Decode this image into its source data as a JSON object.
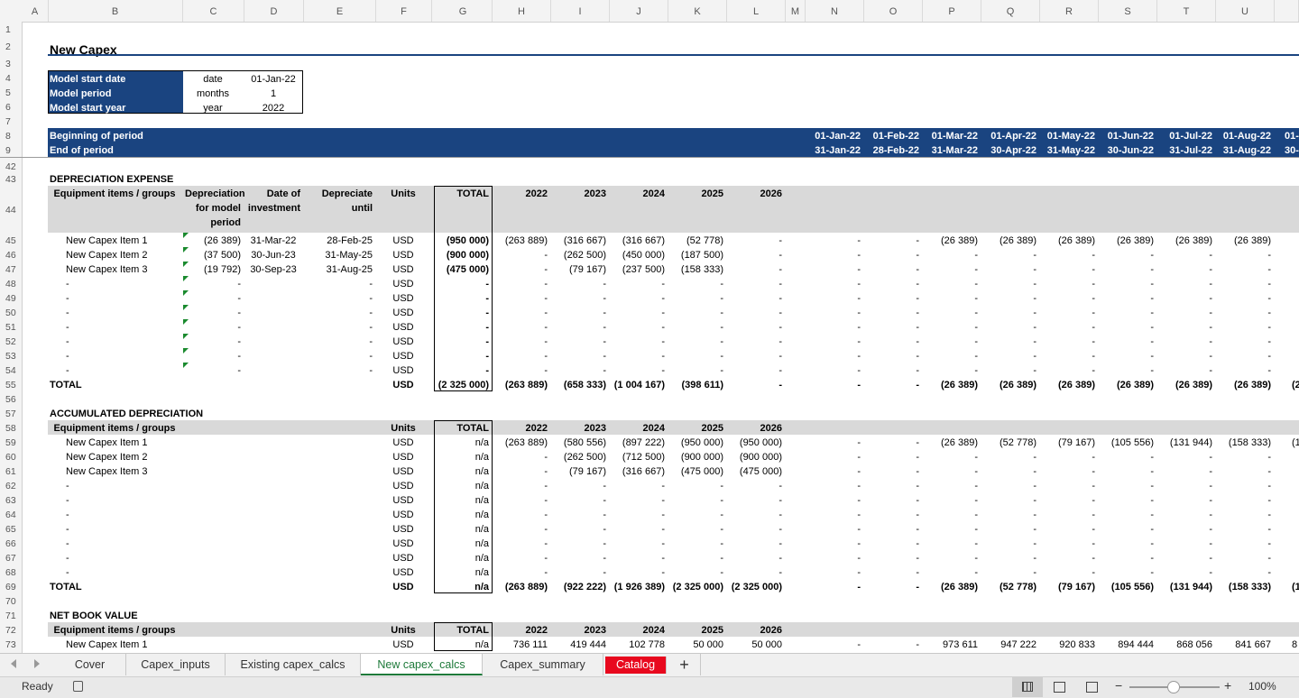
{
  "columns": [
    "A",
    "B",
    "C",
    "D",
    "E",
    "F",
    "G",
    "H",
    "I",
    "J",
    "K",
    "L",
    "M",
    "N",
    "O",
    "P",
    "Q",
    "R",
    "S",
    "T",
    "U"
  ],
  "title": "New Capex",
  "params": [
    {
      "label": "Model start date",
      "unit": "date",
      "value": "01-Jan-22"
    },
    {
      "label": "Model period",
      "unit": "months",
      "value": "1"
    },
    {
      "label": "Model start year",
      "unit": "year",
      "value": "2022"
    }
  ],
  "timeline": {
    "begin_label": "Beginning of period",
    "end_label": "End of period",
    "begin": [
      "01-Jan-22",
      "01-Feb-22",
      "01-Mar-22",
      "01-Apr-22",
      "01-May-22",
      "01-Jun-22",
      "01-Jul-22",
      "01-Aug-22",
      "01-"
    ],
    "end": [
      "31-Jan-22",
      "28-Feb-22",
      "31-Mar-22",
      "30-Apr-22",
      "31-May-22",
      "30-Jun-22",
      "31-Jul-22",
      "31-Aug-22",
      "30-"
    ]
  },
  "years": [
    "2022",
    "2023",
    "2024",
    "2025",
    "2026"
  ],
  "sections": [
    {
      "title": "DEPRECIATION EXPENSE",
      "title_row": "43",
      "header_row": "44",
      "headers": {
        "item": "Equipment items / groups",
        "c": "Depreciation for model period",
        "d": "Date of investment",
        "e": "Depreciate until",
        "units": "Units",
        "total": "TOTAL"
      },
      "rows": [
        {
          "n": "45",
          "item": "New Capex Item 1",
          "c": "(26 389)",
          "d": "31-Mar-22",
          "e": "28-Feb-25",
          "units": "USD",
          "total": "(950 000)",
          "y": [
            "(263 889)",
            "(316 667)",
            "(316 667)",
            "(52 778)",
            "-"
          ],
          "m": [
            "-",
            "-",
            "(26 389)",
            "(26 389)",
            "(26 389)",
            "(26 389)",
            "(26 389)",
            "(26 389)"
          ],
          "flag": true
        },
        {
          "n": "46",
          "item": "New Capex Item 2",
          "c": "(37 500)",
          "d": "30-Jun-23",
          "e": "31-May-25",
          "units": "USD",
          "total": "(900 000)",
          "y": [
            "-",
            "(262 500)",
            "(450 000)",
            "(187 500)",
            "-"
          ],
          "m": [
            "-",
            "-",
            "-",
            "-",
            "-",
            "-",
            "-",
            "-"
          ],
          "flag": true
        },
        {
          "n": "47",
          "item": "New Capex Item 3",
          "c": "(19 792)",
          "d": "30-Sep-23",
          "e": "31-Aug-25",
          "units": "USD",
          "total": "(475 000)",
          "y": [
            "-",
            "(79 167)",
            "(237 500)",
            "(158 333)",
            "-"
          ],
          "m": [
            "-",
            "-",
            "-",
            "-",
            "-",
            "-",
            "-",
            "-"
          ],
          "flag": true
        },
        {
          "n": "48",
          "item": "-",
          "c": "-",
          "d": "",
          "e": "-",
          "units": "USD",
          "total": "-",
          "y": [
            "-",
            "-",
            "-",
            "-",
            "-"
          ],
          "m": [
            "-",
            "-",
            "-",
            "-",
            "-",
            "-",
            "-",
            "-"
          ],
          "flag": true
        },
        {
          "n": "49",
          "item": "-",
          "c": "-",
          "d": "",
          "e": "-",
          "units": "USD",
          "total": "-",
          "y": [
            "-",
            "-",
            "-",
            "-",
            "-"
          ],
          "m": [
            "-",
            "-",
            "-",
            "-",
            "-",
            "-",
            "-",
            "-"
          ],
          "flag": true
        },
        {
          "n": "50",
          "item": "-",
          "c": "-",
          "d": "",
          "e": "-",
          "units": "USD",
          "total": "-",
          "y": [
            "-",
            "-",
            "-",
            "-",
            "-"
          ],
          "m": [
            "-",
            "-",
            "-",
            "-",
            "-",
            "-",
            "-",
            "-"
          ],
          "flag": true
        },
        {
          "n": "51",
          "item": "-",
          "c": "-",
          "d": "",
          "e": "-",
          "units": "USD",
          "total": "-",
          "y": [
            "-",
            "-",
            "-",
            "-",
            "-"
          ],
          "m": [
            "-",
            "-",
            "-",
            "-",
            "-",
            "-",
            "-",
            "-"
          ],
          "flag": true
        },
        {
          "n": "52",
          "item": "-",
          "c": "-",
          "d": "",
          "e": "-",
          "units": "USD",
          "total": "-",
          "y": [
            "-",
            "-",
            "-",
            "-",
            "-"
          ],
          "m": [
            "-",
            "-",
            "-",
            "-",
            "-",
            "-",
            "-",
            "-"
          ],
          "flag": true
        },
        {
          "n": "53",
          "item": "-",
          "c": "-",
          "d": "",
          "e": "-",
          "units": "USD",
          "total": "-",
          "y": [
            "-",
            "-",
            "-",
            "-",
            "-"
          ],
          "m": [
            "-",
            "-",
            "-",
            "-",
            "-",
            "-",
            "-",
            "-"
          ],
          "flag": true
        },
        {
          "n": "54",
          "item": "-",
          "c": "-",
          "d": "",
          "e": "-",
          "units": "USD",
          "total": "-",
          "y": [
            "-",
            "-",
            "-",
            "-",
            "-"
          ],
          "m": [
            "-",
            "-",
            "-",
            "-",
            "-",
            "-",
            "-",
            "-"
          ],
          "flag": true
        }
      ],
      "total_row": {
        "n": "55",
        "label": "TOTAL",
        "units": "USD",
        "total": "(2 325 000)",
        "y": [
          "(263 889)",
          "(658 333)",
          "(1 004 167)",
          "(398 611)",
          "-"
        ],
        "m": [
          "-",
          "-",
          "(26 389)",
          "(26 389)",
          "(26 389)",
          "(26 389)",
          "(26 389)",
          "(26 389)"
        ],
        "tail": "(2"
      },
      "gap_row": "56"
    },
    {
      "title": "ACCUMULATED DEPRECIATION",
      "title_row": "57",
      "header_row": "58",
      "headers": {
        "item": "Equipment items / groups",
        "units": "Units",
        "total": "TOTAL"
      },
      "rows": [
        {
          "n": "59",
          "item": "New Capex Item 1",
          "units": "USD",
          "total": "n/a",
          "y": [
            "(263 889)",
            "(580 556)",
            "(897 222)",
            "(950 000)",
            "(950 000)"
          ],
          "m": [
            "-",
            "-",
            "(26 389)",
            "(52 778)",
            "(79 167)",
            "(105 556)",
            "(131 944)",
            "(158 333)"
          ],
          "tail": "(1"
        },
        {
          "n": "60",
          "item": "New Capex Item 2",
          "units": "USD",
          "total": "n/a",
          "y": [
            "-",
            "(262 500)",
            "(712 500)",
            "(900 000)",
            "(900 000)"
          ],
          "m": [
            "-",
            "-",
            "-",
            "-",
            "-",
            "-",
            "-",
            "-"
          ]
        },
        {
          "n": "61",
          "item": "New Capex Item 3",
          "units": "USD",
          "total": "n/a",
          "y": [
            "-",
            "(79 167)",
            "(316 667)",
            "(475 000)",
            "(475 000)"
          ],
          "m": [
            "-",
            "-",
            "-",
            "-",
            "-",
            "-",
            "-",
            "-"
          ]
        },
        {
          "n": "62",
          "item": "-",
          "units": "USD",
          "total": "n/a",
          "y": [
            "-",
            "-",
            "-",
            "-",
            "-"
          ],
          "m": [
            "-",
            "-",
            "-",
            "-",
            "-",
            "-",
            "-",
            "-"
          ]
        },
        {
          "n": "63",
          "item": "-",
          "units": "USD",
          "total": "n/a",
          "y": [
            "-",
            "-",
            "-",
            "-",
            "-"
          ],
          "m": [
            "-",
            "-",
            "-",
            "-",
            "-",
            "-",
            "-",
            "-"
          ]
        },
        {
          "n": "64",
          "item": "-",
          "units": "USD",
          "total": "n/a",
          "y": [
            "-",
            "-",
            "-",
            "-",
            "-"
          ],
          "m": [
            "-",
            "-",
            "-",
            "-",
            "-",
            "-",
            "-",
            "-"
          ]
        },
        {
          "n": "65",
          "item": "-",
          "units": "USD",
          "total": "n/a",
          "y": [
            "-",
            "-",
            "-",
            "-",
            "-"
          ],
          "m": [
            "-",
            "-",
            "-",
            "-",
            "-",
            "-",
            "-",
            "-"
          ]
        },
        {
          "n": "66",
          "item": "-",
          "units": "USD",
          "total": "n/a",
          "y": [
            "-",
            "-",
            "-",
            "-",
            "-"
          ],
          "m": [
            "-",
            "-",
            "-",
            "-",
            "-",
            "-",
            "-",
            "-"
          ]
        },
        {
          "n": "67",
          "item": "-",
          "units": "USD",
          "total": "n/a",
          "y": [
            "-",
            "-",
            "-",
            "-",
            "-"
          ],
          "m": [
            "-",
            "-",
            "-",
            "-",
            "-",
            "-",
            "-",
            "-"
          ]
        },
        {
          "n": "68",
          "item": "-",
          "units": "USD",
          "total": "n/a",
          "y": [
            "-",
            "-",
            "-",
            "-",
            "-"
          ],
          "m": [
            "-",
            "-",
            "-",
            "-",
            "-",
            "-",
            "-",
            "-"
          ]
        }
      ],
      "total_row": {
        "n": "69",
        "label": "TOTAL",
        "units": "USD",
        "total": "n/a",
        "y": [
          "(263 889)",
          "(922 222)",
          "(1 926 389)",
          "(2 325 000)",
          "(2 325 000)"
        ],
        "m": [
          "-",
          "-",
          "(26 389)",
          "(52 778)",
          "(79 167)",
          "(105 556)",
          "(131 944)",
          "(158 333)"
        ],
        "tail": "(1"
      },
      "gap_row": "70"
    },
    {
      "title": "NET BOOK VALUE",
      "title_row": "71",
      "header_row": "72",
      "headers": {
        "item": "Equipment items / groups",
        "units": "Units",
        "total": "TOTAL"
      },
      "rows": [
        {
          "n": "73",
          "item": "New Capex Item 1",
          "units": "USD",
          "total": "n/a",
          "y": [
            "736 111",
            "419 444",
            "102 778",
            "50 000",
            "50 000"
          ],
          "m": [
            "-",
            "-",
            "973 611",
            "947 222",
            "920 833",
            "894 444",
            "868 056",
            "841 667"
          ],
          "tail": "8"
        }
      ]
    }
  ],
  "row_numbers_top": [
    "1",
    "2",
    "3",
    "4",
    "5",
    "6",
    "7",
    "8",
    "9",
    "42"
  ],
  "tabs": [
    {
      "label": "Cover"
    },
    {
      "label": "Capex_inputs"
    },
    {
      "label": "Existing capex_calcs"
    },
    {
      "label": "New capex_calcs",
      "active": true
    },
    {
      "label": "Capex_summary"
    },
    {
      "label": "Catalog",
      "red": true
    }
  ],
  "add_tab": "+",
  "status": {
    "ready": "Ready",
    "zoom": "100%",
    "zoom_minus": "−",
    "zoom_plus": "+"
  },
  "colors": {
    "header_blue": "#1a4480",
    "gray_band": "#d9d9d9",
    "active_tab": "#1e7a3a",
    "catalog_tab": "#e8091e"
  }
}
